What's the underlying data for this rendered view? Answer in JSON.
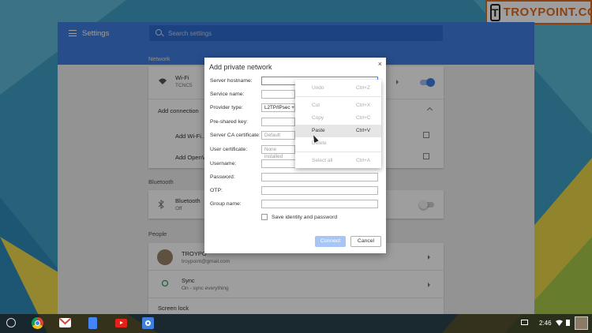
{
  "logo": {
    "text": "TROYPOINT.COM",
    "mark": "T"
  },
  "settings": {
    "title": "Settings",
    "search_placeholder": "Search settings",
    "network": {
      "label": "Network",
      "wifi_name": "Wi-Fi",
      "wifi_network": "TCNC5",
      "add_connection": "Add connection",
      "add_wifi": "Add Wi-Fi...",
      "add_openvpn": "Add OpenVPN"
    },
    "bluetooth": {
      "label": "Bluetooth",
      "name": "Bluetooth",
      "status": "Off"
    },
    "people": {
      "label": "People",
      "account_name": "TROYPO",
      "account_email": "troypoint@gmail.com",
      "sync_label": "Sync",
      "sync_status": "On - sync everything",
      "screen_lock": "Screen lock"
    }
  },
  "dialog": {
    "title": "Add private network",
    "close": "×",
    "fields": {
      "server_hostname": "Server hostname:",
      "service_name": "Service name:",
      "provider_type": "Provider type:",
      "provider_value": "L2TP/IPsec +",
      "pre_shared_key": "Pre-shared key:",
      "server_ca": "Server CA certificate:",
      "server_ca_value": "Default",
      "user_cert": "User certificate:",
      "user_cert_value": "None installed",
      "username": "Username:",
      "password": "Password:",
      "otp": "OTP:",
      "group_name": "Group name:"
    },
    "save_identity": "Save identity and password",
    "connect": "Connect",
    "cancel": "Cancel"
  },
  "context_menu": {
    "items": [
      {
        "label": "Undo",
        "shortcut": "Ctrl+Z"
      },
      {
        "label": "Cut",
        "shortcut": "Ctrl+X"
      },
      {
        "label": "Copy",
        "shortcut": "Ctrl+C"
      },
      {
        "label": "Paste",
        "shortcut": "Ctrl+V"
      },
      {
        "label": "Delete",
        "shortcut": ""
      },
      {
        "label": "Select all",
        "shortcut": "Ctrl+A"
      }
    ]
  },
  "shelf": {
    "time": "2:46",
    "apps": [
      "chrome-icon",
      "gmail-icon",
      "docs-icon",
      "youtube-icon",
      "settings-icon"
    ]
  },
  "colors": {
    "header_blue": "#3f7fe0",
    "toggle_on": "#3f7fe0",
    "logo_orange": "#e36a1e"
  }
}
